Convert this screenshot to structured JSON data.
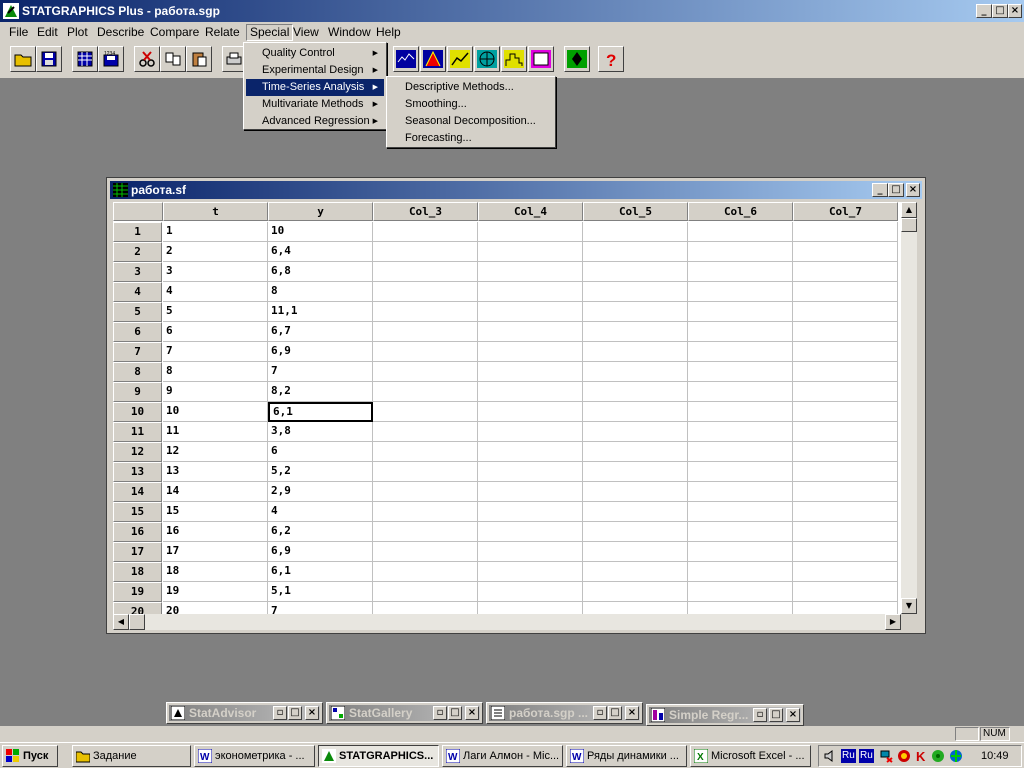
{
  "app": {
    "title": "STATGRAPHICS Plus - работа.sgp",
    "window_buttons": [
      "_",
      "□",
      "×"
    ]
  },
  "menubar": {
    "items": [
      "File",
      "Edit",
      "Plot",
      "Describe",
      "Compare",
      "Relate",
      "Special",
      "View",
      "Window",
      "Help"
    ]
  },
  "special_menu": {
    "items": [
      "Quality Control",
      "Experimental Design",
      "Time-Series Analysis",
      "Multivariate Methods",
      "Advanced Regression"
    ],
    "selected": "Time-Series Analysis"
  },
  "timeseries_submenu": {
    "items": [
      "Descriptive Methods...",
      "Smoothing...",
      "Seasonal Decomposition...",
      "Forecasting..."
    ]
  },
  "datasheet": {
    "title": "работа.sf",
    "columns": [
      "t",
      "y",
      "Col_3",
      "Col_4",
      "Col_5",
      "Col_6",
      "Col_7"
    ],
    "rows": [
      {
        "n": "1",
        "t": "1",
        "y": "10"
      },
      {
        "n": "2",
        "t": "2",
        "y": "6,4"
      },
      {
        "n": "3",
        "t": "3",
        "y": "6,8"
      },
      {
        "n": "4",
        "t": "4",
        "y": "8"
      },
      {
        "n": "5",
        "t": "5",
        "y": "11,1"
      },
      {
        "n": "6",
        "t": "6",
        "y": "6,7"
      },
      {
        "n": "7",
        "t": "7",
        "y": "6,9"
      },
      {
        "n": "8",
        "t": "8",
        "y": "7"
      },
      {
        "n": "9",
        "t": "9",
        "y": "8,2"
      },
      {
        "n": "10",
        "t": "10",
        "y": "6,1"
      },
      {
        "n": "11",
        "t": "11",
        "y": "3,8"
      },
      {
        "n": "12",
        "t": "12",
        "y": "6"
      },
      {
        "n": "13",
        "t": "13",
        "y": "5,2"
      },
      {
        "n": "14",
        "t": "14",
        "y": "2,9"
      },
      {
        "n": "15",
        "t": "15",
        "y": "4"
      },
      {
        "n": "16",
        "t": "16",
        "y": "6,2"
      },
      {
        "n": "17",
        "t": "17",
        "y": "6,9"
      },
      {
        "n": "18",
        "t": "18",
        "y": "6,1"
      },
      {
        "n": "19",
        "t": "19",
        "y": "5,1"
      },
      {
        "n": "20",
        "t": "20",
        "y": "7"
      }
    ],
    "active_cell": {
      "row": "10",
      "column": "y"
    }
  },
  "minimized_windows": [
    "StatAdvisor",
    "StatGallery",
    "работа.sgp ...",
    "Simple Regr..."
  ],
  "statusbar": {
    "num": "NUM"
  },
  "taskbar": {
    "start": "Пуск",
    "tasks": [
      "Задание",
      "эконометрика - ...",
      "STATGRAPHICS...",
      "Лаги Алмон - Mic...",
      "Ряды динамики ...",
      "Microsoft Excel - ..."
    ],
    "active_task": "STATGRAPHICS...",
    "lang": "Ru",
    "clock": "10:49"
  },
  "colors": {
    "titlebar": "#0a246a",
    "face": "#d4d0c8",
    "desktop": "#808080",
    "selection": "#0a246a"
  }
}
